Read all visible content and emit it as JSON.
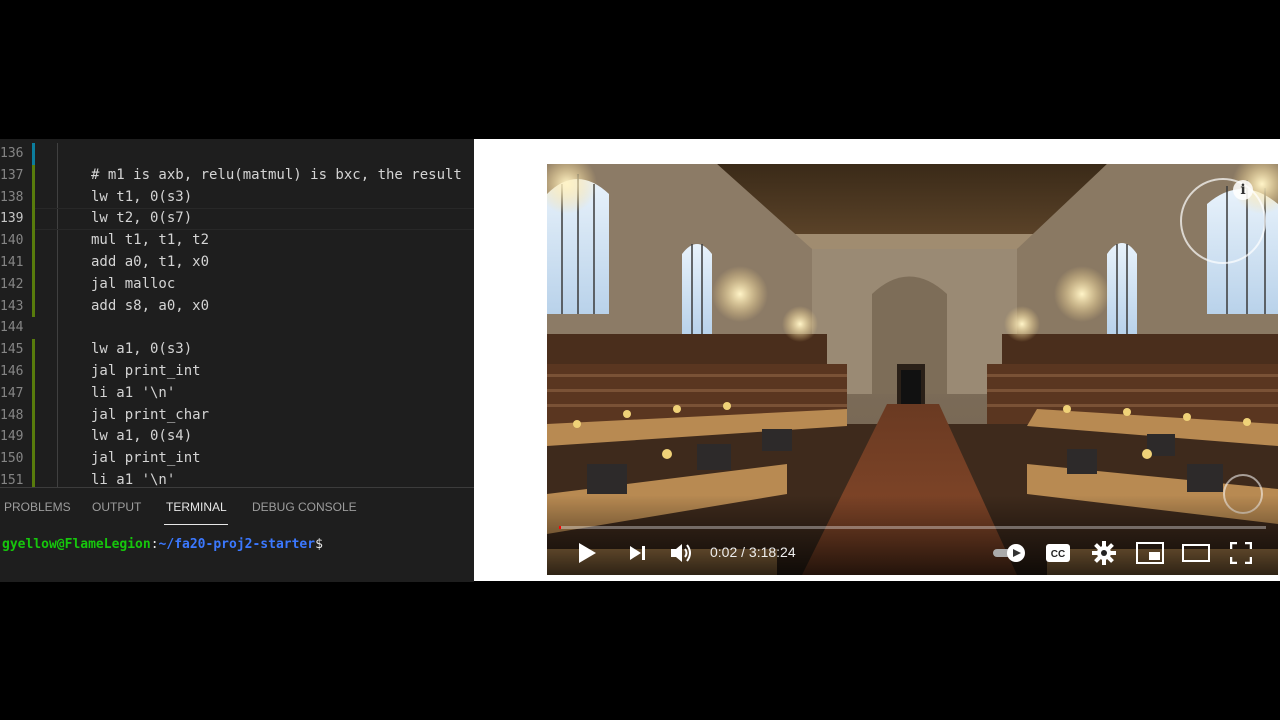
{
  "editor": {
    "lines": [
      {
        "num": "136",
        "code": "",
        "mod": "changed"
      },
      {
        "num": "137",
        "code": "# m1 is axb, relu(matmul) is bxc, the result",
        "mod": "added"
      },
      {
        "num": "138",
        "code": "lw t1, 0(s3)",
        "mod": "added"
      },
      {
        "num": "139",
        "code": "lw t2, 0(s7)",
        "mod": "added"
      },
      {
        "num": "140",
        "code": "mul t1, t1, t2",
        "mod": "added"
      },
      {
        "num": "141",
        "code": "add a0, t1, x0",
        "mod": "added"
      },
      {
        "num": "142",
        "code": "jal malloc",
        "mod": "added"
      },
      {
        "num": "143",
        "code": "add s8, a0, x0",
        "mod": "added"
      },
      {
        "num": "144",
        "code": "",
        "mod": ""
      },
      {
        "num": "145",
        "code": "lw a1, 0(s3)",
        "mod": "added"
      },
      {
        "num": "146",
        "code": "jal print_int",
        "mod": "added"
      },
      {
        "num": "147",
        "code": "li a1 '\\n'",
        "mod": "added"
      },
      {
        "num": "148",
        "code": "jal print_char",
        "mod": "added"
      },
      {
        "num": "149",
        "code": "lw a1, 0(s4)",
        "mod": "added"
      },
      {
        "num": "150",
        "code": "jal print_int",
        "mod": "added"
      },
      {
        "num": "151",
        "code": "li a1 '\\n'",
        "mod": "added"
      }
    ],
    "active_line": "139"
  },
  "panel": {
    "tabs": [
      {
        "label": "PROBLEMS",
        "active": false
      },
      {
        "label": "OUTPUT",
        "active": false
      },
      {
        "label": "TERMINAL",
        "active": true
      },
      {
        "label": "DEBUG CONSOLE",
        "active": false
      }
    ],
    "prompt": {
      "user_host": "gyellow@FlameLegion",
      "colon": ":",
      "path": "~/fa20-proj2-starter",
      "dollar": "$"
    }
  },
  "video": {
    "time": "0:02 / 3:18:24",
    "progress_fraction": 0.0002,
    "controls": {
      "play": "play-icon",
      "next": "next-icon",
      "volume": "volume-icon",
      "autoplay": "autoplay-toggle-icon",
      "captions": "captions-icon",
      "settings": "gear-icon",
      "miniplayer": "miniplayer-icon",
      "theater": "theater-mode-icon",
      "fullscreen": "fullscreen-icon"
    },
    "info_glyph": "i"
  },
  "colors": {
    "editor_bg": "#1e1e1e",
    "prompt_user": "#16c60c",
    "prompt_path": "#3b78ff",
    "progress": "#ff0000"
  }
}
